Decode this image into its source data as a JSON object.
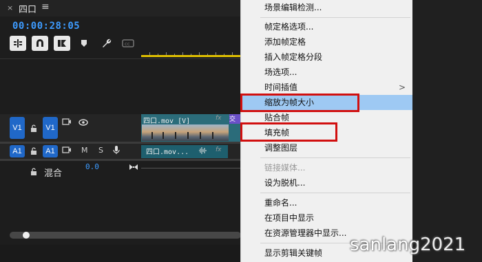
{
  "panel": {
    "close": "×",
    "sequence_name": "四口",
    "menu_glyph": "≡",
    "timecode": "00:00:28:05"
  },
  "tracks": {
    "v1_target": "V1",
    "v1_source": "V1",
    "a1_target": "A1",
    "a1_source": "A1",
    "mute": "M",
    "solo": "S",
    "mix_label": "混合",
    "mix_value": "0.0"
  },
  "clips": {
    "video_label": "四口.mov [V]",
    "audio_label": "四口.mov...",
    "fx": "fx",
    "transition": "交"
  },
  "context_menu": {
    "items": [
      {
        "label": "场景编辑检测...",
        "disabled": false
      },
      {
        "label": "帧定格选项...",
        "disabled": false
      },
      {
        "label": "添加帧定格",
        "disabled": false
      },
      {
        "label": "插入帧定格分段",
        "disabled": false
      },
      {
        "label": "场选项...",
        "disabled": false
      },
      {
        "label": "时间插值",
        "disabled": false,
        "submenu": ">"
      },
      {
        "label": "缩放为帧大小",
        "disabled": false,
        "highlighted": true
      },
      {
        "label": "贴合帧",
        "disabled": false
      },
      {
        "label": "填充帧",
        "disabled": false
      },
      {
        "label": "调整图层",
        "disabled": false
      },
      {
        "label": "链接媒体...",
        "disabled": true
      },
      {
        "label": "设为脱机...",
        "disabled": false
      },
      {
        "label": "重命名...",
        "disabled": false
      },
      {
        "label": "在项目中显示",
        "disabled": false
      },
      {
        "label": "在资源管理器中显示...",
        "disabled": false
      },
      {
        "label": "显示剪辑关键帧",
        "disabled": false
      }
    ]
  },
  "watermark": "sanlang2021",
  "colors": {
    "timecode_blue": "#3d9bff",
    "track_button_blue": "#2068c8",
    "menu_highlight": "#9ec9f3",
    "annotation_red": "#d10f0f",
    "work_area_yellow": "#e0c000"
  },
  "icons": [
    "snap-icon",
    "linked-selection-icon",
    "add-marker-icon",
    "marker-icon",
    "wrench-icon",
    "captions-icon",
    "lock-icon",
    "film-icon",
    "eye-icon",
    "microphone-icon",
    "mix-end-icon"
  ]
}
